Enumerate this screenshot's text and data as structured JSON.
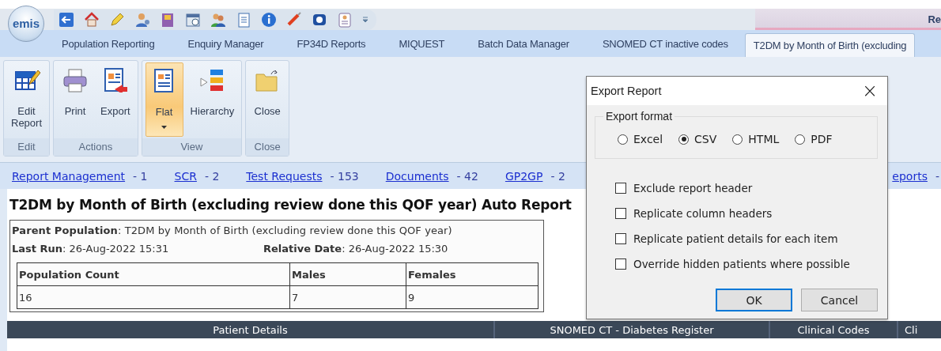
{
  "logo": {
    "text": "emis"
  },
  "title_strip": {
    "text": "Re"
  },
  "module_tabs": [
    {
      "label": "Population Reporting",
      "selected": false
    },
    {
      "label": "Enquiry Manager",
      "selected": false
    },
    {
      "label": "FP34D Reports",
      "selected": false
    },
    {
      "label": "MIQUEST",
      "selected": false
    },
    {
      "label": "Batch Data Manager",
      "selected": false
    },
    {
      "label": "SNOMED CT inactive codes",
      "selected": false
    },
    {
      "label": "T2DM by Month of Birth (excluding",
      "selected": true
    }
  ],
  "ribbon": [
    {
      "label": "Edit",
      "buttons": [
        {
          "label": "Edit Report",
          "selected": false,
          "dropdown": false
        }
      ]
    },
    {
      "label": "Actions",
      "buttons": [
        {
          "label": "Print",
          "selected": false,
          "dropdown": false
        },
        {
          "label": "Export",
          "selected": false,
          "dropdown": false
        }
      ]
    },
    {
      "label": "View",
      "buttons": [
        {
          "label": "Flat",
          "selected": true,
          "dropdown": true
        },
        {
          "label": "Hierarchy",
          "selected": false,
          "dropdown": false
        }
      ]
    },
    {
      "label": "Close",
      "buttons": [
        {
          "label": "Close",
          "selected": false,
          "dropdown": false
        }
      ]
    }
  ],
  "links": [
    {
      "label": "Report Management",
      "count": "- 1"
    },
    {
      "label": "SCR",
      "count": "- 2"
    },
    {
      "label": "Test Requests",
      "count": "- 153"
    },
    {
      "label": "Documents",
      "count": "- 42"
    },
    {
      "label": "GP2GP",
      "count": "- 2"
    },
    {
      "label": "eports",
      "count": "-"
    }
  ],
  "report": {
    "title": "T2DM by Month of Birth (excluding review done this QOF year) Auto Report",
    "parent_population": "**Parent Population**: T2DM by Month of Birth (excluding review done this QOF year)",
    "last_run": "**Last Run**: 26-Aug-2022 15:31",
    "relative_date": "**Relative Date**: 26-Aug-2022 15:30",
    "summary": {
      "columns": [
        "Population Count",
        "Males",
        "Females"
      ],
      "rows": [
        [
          "16",
          "7",
          "9"
        ]
      ]
    },
    "table": {
      "columns": [
        "Patient Details",
        "SNOMED CT - Diabetes Register",
        "Clinical Codes",
        "Cli"
      ]
    }
  },
  "dialog": {
    "title": "Export Report",
    "close": "×",
    "format": {
      "label": "Export format",
      "options": [
        {
          "label": "Excel",
          "selected": false
        },
        {
          "label": "CSV",
          "selected": true
        },
        {
          "label": "HTML",
          "selected": false
        },
        {
          "label": "PDF",
          "selected": false
        }
      ]
    },
    "options": [
      {
        "label": "Exclude report header",
        "checked": false
      },
      {
        "label": "Replicate column headers",
        "checked": false
      },
      {
        "label": "Replicate patient details for each item",
        "checked": false
      },
      {
        "label": "Override hidden patients where possible",
        "checked": false
      }
    ],
    "buttons": [
      {
        "label": "OK",
        "default": true
      },
      {
        "label": "Cancel",
        "default": false
      }
    ]
  }
}
